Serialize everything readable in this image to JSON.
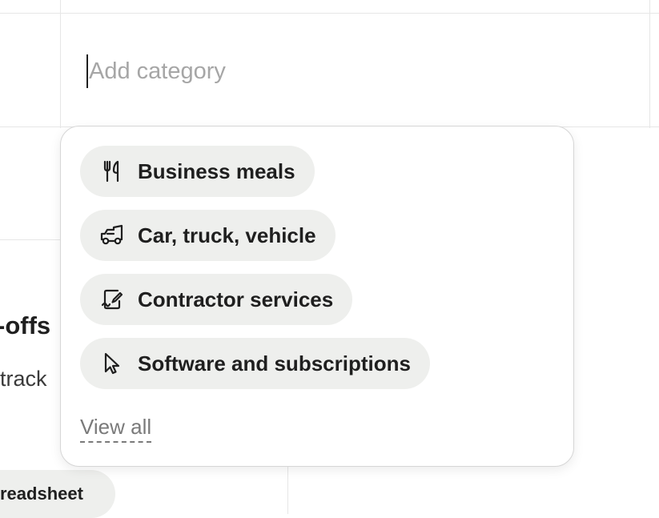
{
  "category_field": {
    "placeholder": "Add category",
    "value": ""
  },
  "background": {
    "heading": "-offs",
    "subtext": "track",
    "chip_label": "readsheet"
  },
  "dropdown": {
    "options": [
      {
        "label": "Business meals",
        "icon": "fork-knife-icon"
      },
      {
        "label": "Car, truck, vehicle",
        "icon": "car-icon"
      },
      {
        "label": "Contractor services",
        "icon": "contract-sign-icon"
      },
      {
        "label": "Software and subscriptions",
        "icon": "cursor-pointer-icon"
      }
    ],
    "view_all_label": "View all"
  },
  "colors": {
    "chip_background": "#eeefed",
    "text": "#1f1f1f",
    "placeholder": "#a6a6a6",
    "link_muted": "#7a7a7a"
  }
}
